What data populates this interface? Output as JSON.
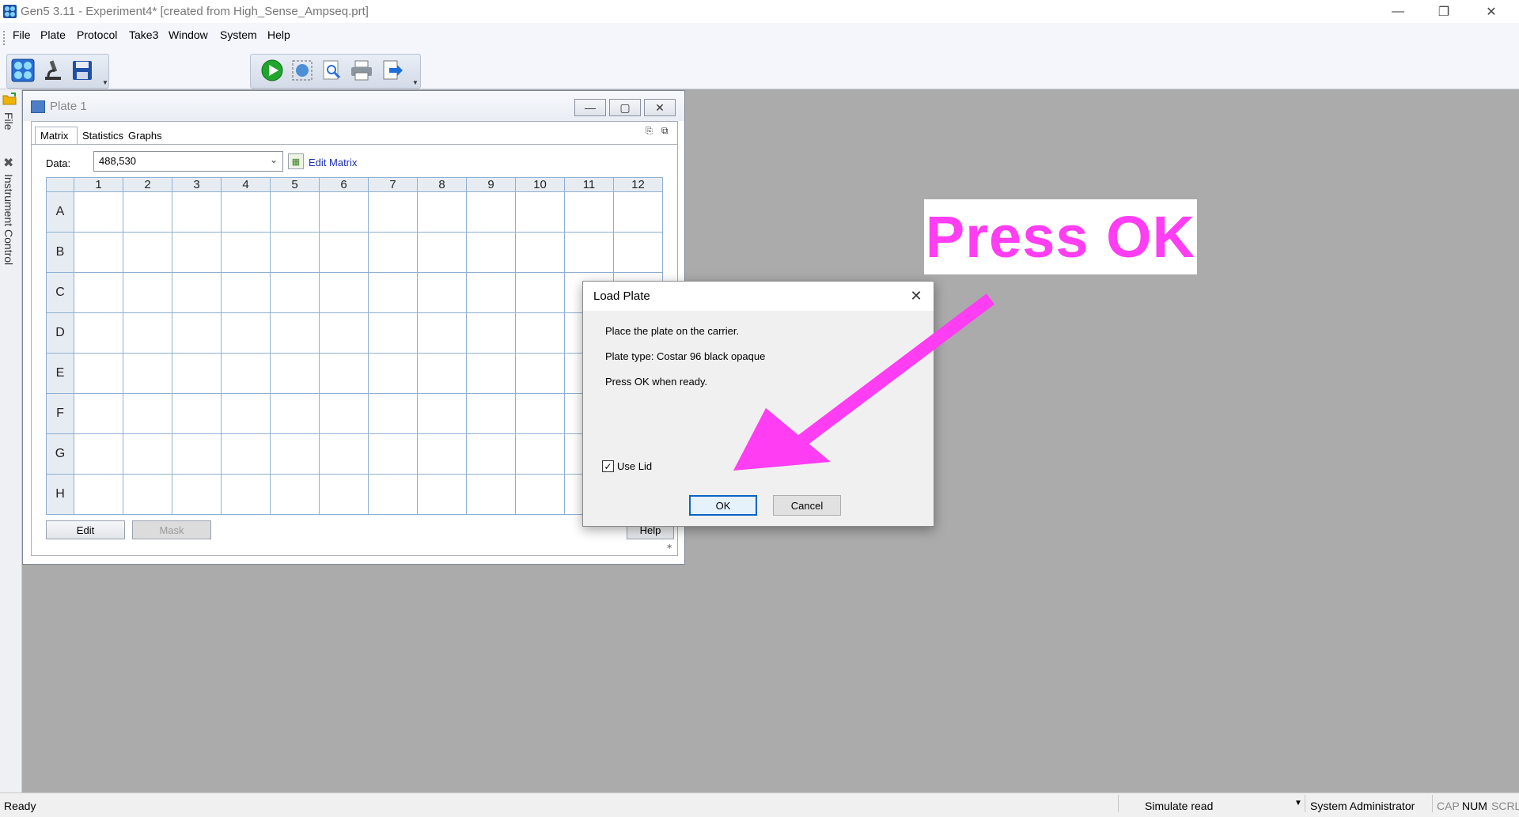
{
  "window": {
    "title": "Gen5 3.11 - Experiment4* [created from High_Sense_Ampseq.prt]"
  },
  "menu": [
    "File",
    "Plate",
    "Protocol",
    "Take3",
    "Window",
    "System",
    "Help"
  ],
  "dock_tabs": {
    "file": "File",
    "instrument": "Instrument Control"
  },
  "plate_window": {
    "title": "Plate 1",
    "tabs": [
      "Matrix",
      "Statistics",
      "Graphs"
    ],
    "data_label": "Data:",
    "data_value": "488,530",
    "edit_matrix": "Edit Matrix",
    "columns": [
      "1",
      "2",
      "3",
      "4",
      "5",
      "6",
      "7",
      "8",
      "9",
      "10",
      "11",
      "12"
    ],
    "rows": [
      "A",
      "B",
      "C",
      "D",
      "E",
      "F",
      "G",
      "H"
    ],
    "buttons": {
      "edit": "Edit",
      "mask": "Mask",
      "help": "Help"
    }
  },
  "dialog": {
    "title": "Load Plate",
    "line1": "Place the plate on the carrier.",
    "line2": "Plate type: Costar 96 black opaque",
    "line3": "Press OK when ready.",
    "use_lid": "Use Lid",
    "use_lid_checked": true,
    "ok": "OK",
    "cancel": "Cancel"
  },
  "annotation": {
    "text": "Press OK",
    "color": "#ff3df2"
  },
  "status": {
    "left": "Ready",
    "mode": "Simulate read",
    "user": "System Administrator",
    "cap": "CAP",
    "num": "NUM",
    "scrl": "SCRL"
  }
}
